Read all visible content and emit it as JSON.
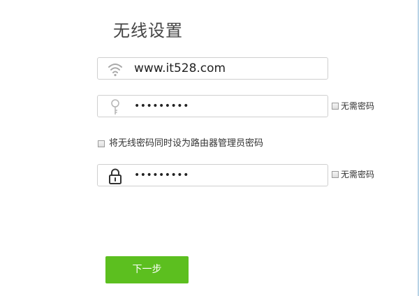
{
  "page": {
    "title": "无线设置"
  },
  "wireless": {
    "ssid_value": "www.it528.com",
    "password_value": "•••••••••",
    "no_password_label": "无需密码"
  },
  "same_password": {
    "label": "将无线密码同时设为路由器管理员密码"
  },
  "admin": {
    "password_value": "•••••••••",
    "no_password_label": "无需密码"
  },
  "actions": {
    "next_label": "下一步"
  },
  "icons": {
    "ssid": "wifi-icon",
    "wifi_password": "key-icon",
    "admin_password": "lock-icon"
  },
  "colors": {
    "accent_button": "#5cbf1f",
    "field_border": "#cfcfcf",
    "icon_gray": "#a9a9a9"
  }
}
